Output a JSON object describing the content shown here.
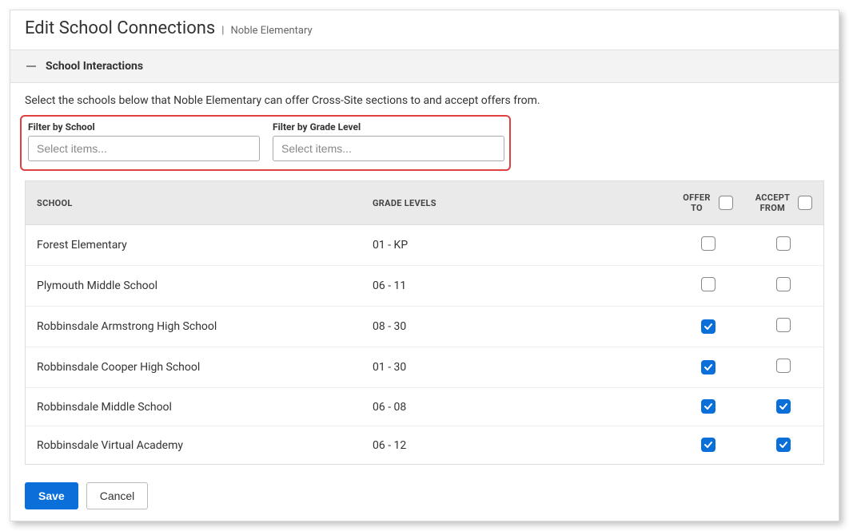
{
  "header": {
    "title": "Edit School Connections",
    "separator": "|",
    "school": "Noble Elementary"
  },
  "section": {
    "title": "School Interactions"
  },
  "instructions": "Select the schools below that Noble Elementary can offer Cross-Site sections to and accept offers from.",
  "filters": {
    "school": {
      "label": "Filter by School",
      "placeholder": "Select items..."
    },
    "grade": {
      "label": "Filter by Grade Level",
      "placeholder": "Select items..."
    }
  },
  "table": {
    "headers": {
      "school": "SCHOOL",
      "grade": "GRADE LEVELS",
      "offer": "OFFER TO",
      "accept": "ACCEPT FROM"
    },
    "offer_all_checked": false,
    "accept_all_checked": false,
    "rows": [
      {
        "school": "Forest Elementary",
        "grade": "01 - KP",
        "offer": false,
        "accept": false
      },
      {
        "school": "Plymouth Middle School",
        "grade": "06 - 11",
        "offer": false,
        "accept": false
      },
      {
        "school": "Robbinsdale Armstrong High School",
        "grade": "08 - 30",
        "offer": true,
        "accept": false
      },
      {
        "school": "Robbinsdale Cooper High School",
        "grade": "01 - 30",
        "offer": true,
        "accept": false
      },
      {
        "school": "Robbinsdale Middle School",
        "grade": "06 - 08",
        "offer": true,
        "accept": true
      },
      {
        "school": "Robbinsdale Virtual Academy",
        "grade": "06 - 12",
        "offer": true,
        "accept": true
      }
    ]
  },
  "footer": {
    "save": "Save",
    "cancel": "Cancel"
  }
}
